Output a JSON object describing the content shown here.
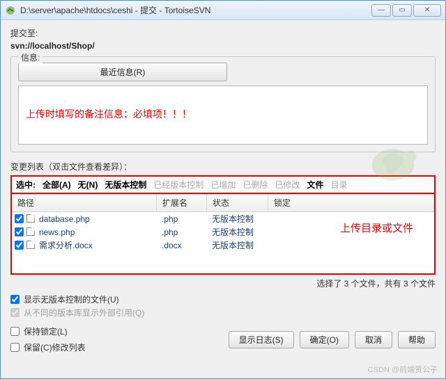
{
  "window": {
    "title": "D:\\server\\apache\\htdocs\\ceshi - 提交 - TortoiseSVN"
  },
  "commit": {
    "to_label": "提交至:",
    "url": "svn://localhost/Shop/",
    "msg_legend": "信息:",
    "recent_btn": "最近信息(R)"
  },
  "annotations": {
    "msg_note": "上传时填写的备注信息：必填项！！！",
    "list_note": "上传目录或文件"
  },
  "changelist": {
    "header": "变更列表（双击文件查看差异）：",
    "select_label": "选中:",
    "all": "全部(A)",
    "none": "无(N)",
    "unversioned": "无版本控制",
    "versioned": "已经版本控制",
    "added": "已增加",
    "deleted": "已删除",
    "modified": "已修改",
    "files": "文件",
    "dirs": "目录",
    "col_path": "路径",
    "col_ext": "扩展名",
    "col_status": "状态",
    "col_lock": "锁定",
    "rows": [
      {
        "name": "database.php",
        "ext": ".php",
        "status": "无版本控制"
      },
      {
        "name": "news.php",
        "ext": ".php",
        "status": "无版本控制"
      },
      {
        "name": "需求分析.docx",
        "ext": ".docx",
        "status": "无版本控制"
      }
    ]
  },
  "options": {
    "show_unversioned": "显示无版本控制的文件(U)",
    "show_externals": "从不同的版本库显示外部引用(Q)",
    "keep_locks": "保持锁定(L)",
    "keep_cl": "保留(C)修改列表"
  },
  "status": {
    "text": "选择了 3 个文件，共有 3 个文件"
  },
  "buttons": {
    "showlog": "显示日志(S)",
    "ok": "确定(O)",
    "cancel": "取消",
    "help": "帮助"
  },
  "watermark": "CSDN @前端贾公子"
}
